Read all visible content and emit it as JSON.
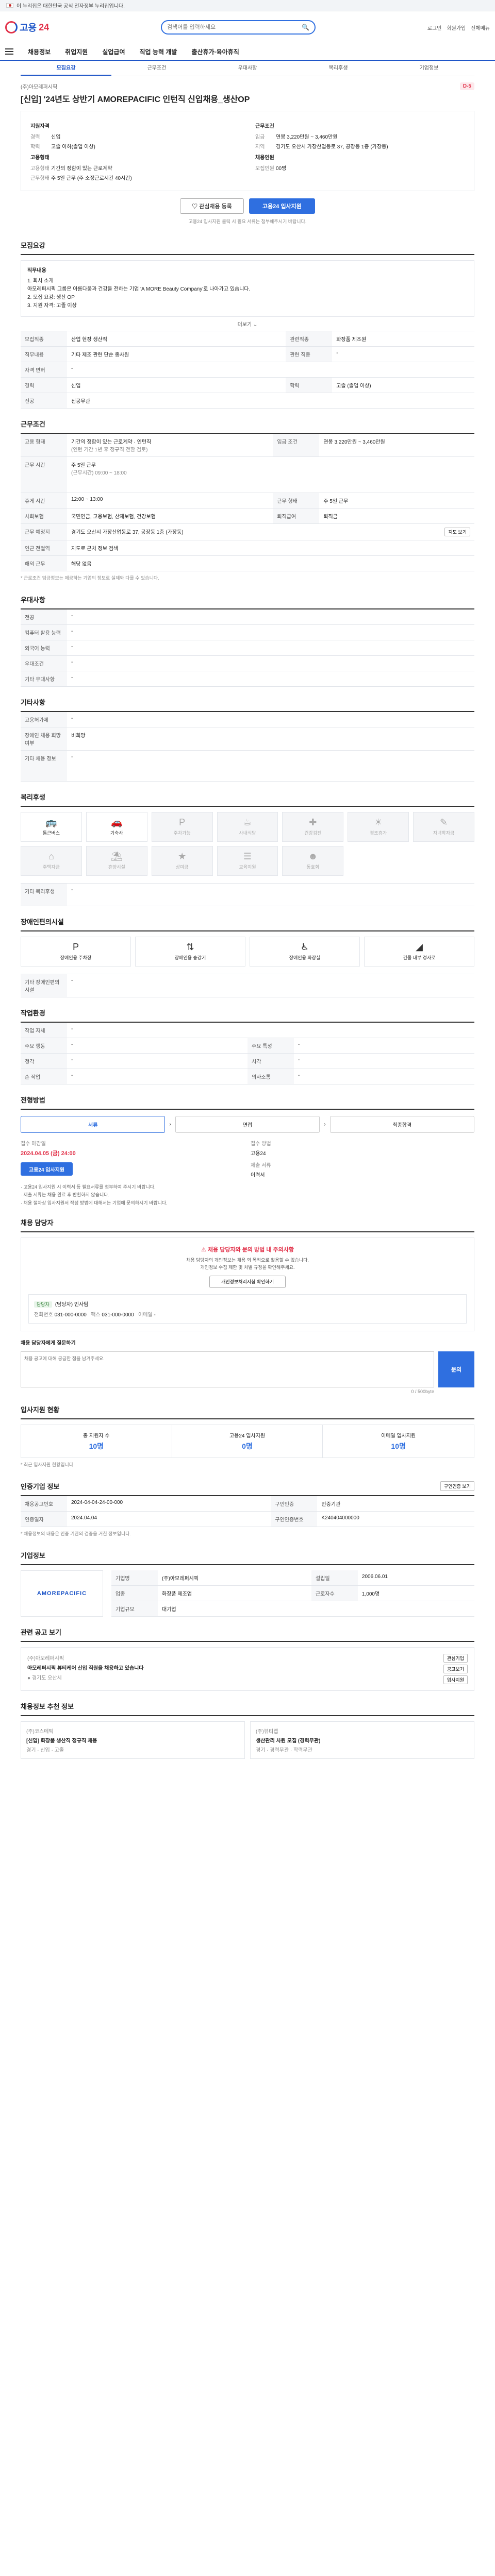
{
  "topbar": {
    "text": "이 누리집은 대한민국 공식 전자정부 누리집입니다."
  },
  "header": {
    "logo_text": "고용",
    "logo_num": "24",
    "search_placeholder": "검색어를 입력하세요",
    "links": [
      "로그인",
      "회원가입",
      "전체메뉴"
    ]
  },
  "gnb": [
    "채용정보",
    "취업지원",
    "실업급여",
    "직업 능력 개발",
    "출산휴가·육아휴직"
  ],
  "subtabs": [
    "모집요강",
    "근무조건",
    "우대사항",
    "복리후생",
    "기업정보"
  ],
  "job": {
    "company": "(주)아모레퍼시픽",
    "title": "[신입] '24년도 상반기 AMOREPACIFIC 인턴직 신입채용_생산OP",
    "dday": "D-5",
    "left_title": "지원자격",
    "left_rows": [
      {
        "k": "경력",
        "v": "신입"
      },
      {
        "k": "학력",
        "v": "고졸 이하(졸업 이상)"
      }
    ],
    "left_title2": "고용형태",
    "left_rows2": [
      {
        "k": "고용형태",
        "v": "기간의 정함이 있는 근로계약"
      },
      {
        "k": "근무형태",
        "v": "주 5일 근무 (주 소정근로시간 40시간)"
      }
    ],
    "right_title": "근무조건",
    "right_rows": [
      {
        "k": "임금",
        "v": "연봉 3,220만원 ~ 3,460만원"
      },
      {
        "k": "지역",
        "v": "경기도 오산시 가장산업동로 37, 공장동 1층 (가장동)"
      }
    ],
    "right_title2": "채용인원",
    "right_rows2": [
      {
        "k": "모집인원",
        "v": "00명"
      }
    ],
    "btn_interest": "관심채용 등록",
    "btn_apply": "고용24 입사지원",
    "small_notice": "고용24 입사지원 클릭 시 필요 서류는 첨부해주시기 바랍니다."
  },
  "recruit": {
    "section": "모집요강",
    "job_title_label": "직무내용",
    "job_lines": [
      "1. 회사 소개",
      "아모레퍼시픽 그룹은 아름다움과 건강을 전하는 기업 'A MORE Beauty Company'로 나아가고 있습니다.",
      "2. 모집 요강: 생산 OP",
      "3. 지원 자격: 고졸 이상"
    ],
    "more": "더보기",
    "rows": [
      {
        "k": "모집직종",
        "v": "산업 현장 생산직",
        "k2": "관련직종",
        "v2": "화장품 제조원"
      },
      {
        "k": "직무내용",
        "v": "기타 제조 관련 단순 종사원",
        "k2": "관련 직종",
        "v2": "-"
      },
      {
        "k": "자격 면허",
        "v": "-",
        "k2": "",
        "v2": ""
      },
      {
        "k": "경력",
        "v": "신입",
        "k2": "학력",
        "v2": "고졸 (졸업 이상)"
      },
      {
        "k": "전공",
        "v": "전공무관",
        "k2": "",
        "v2": ""
      }
    ]
  },
  "conditions": {
    "section": "근무조건",
    "type_label": "고용 형태",
    "type_value": "기간의 정함이 있는 근로계약 · 인턴직",
    "type_value2": "(인턴 기간 1년 후 정규직 전환 검토)",
    "wage_label": "임금 조건",
    "wage_value": "연봉 3,220만원 ~ 3,460만원",
    "hours_label": "근무 시간",
    "hours_value": "주 5일 근무",
    "hours_value2": "(근무시간) 09:00 ~ 18:00",
    "rows": [
      {
        "k": "휴게 시간",
        "v": "12:00 ~ 13:00",
        "k2": "근무 형태",
        "v2": "주 5일 근무"
      },
      {
        "k": "사회보험",
        "v": "국민연금, 고용보험, 산재보험, 건강보험",
        "k2": "퇴직급여",
        "v2": "퇴직금"
      },
      {
        "k": "근무 예정지",
        "v": "경기도 오산시 가장산업동로 37, 공장동 1층 (가장동)",
        "k2": "",
        "v2": ""
      },
      {
        "k": "인근 전철역",
        "v": "지도로 근처 정보 검색",
        "k2": "",
        "v2": ""
      },
      {
        "k": "해외 근무",
        "v": "해당 없음",
        "k2": "",
        "v2": ""
      }
    ],
    "map_btn": "지도 보기",
    "note": "* 근로조건 임금정보는 제공하는 기업의 정보로 실제와 다를 수 있습니다."
  },
  "preferred": {
    "section": "우대사항",
    "rows": [
      {
        "k": "전공",
        "v": "-"
      },
      {
        "k": "컴퓨터 활용 능력",
        "v": "-"
      },
      {
        "k": "외국어 능력",
        "v": "-"
      },
      {
        "k": "우대조건",
        "v": "-"
      },
      {
        "k": "기타 우대사항",
        "v": "-"
      }
    ]
  },
  "etc": {
    "section": "기타사항",
    "rows": [
      {
        "k": "고용허가제",
        "v": "-"
      },
      {
        "k": "장애인 채용 희망여부",
        "v": "비희망"
      },
      {
        "k": "기타 채용 정보",
        "v": "-"
      }
    ]
  },
  "welfare": {
    "section": "복리후생",
    "items": [
      {
        "label": "통근버스",
        "icon": "bus-icon",
        "on": true
      },
      {
        "label": "기숙사",
        "icon": "car-icon",
        "on": true
      },
      {
        "label": "주차가능",
        "icon": "parking-icon",
        "on": false
      },
      {
        "label": "사내식당",
        "icon": "meal-icon",
        "on": false
      },
      {
        "label": "건강검진",
        "icon": "health-icon",
        "on": false
      },
      {
        "label": "경조휴가",
        "icon": "leave-icon",
        "on": false
      },
      {
        "label": "자녀학자금",
        "icon": "school-icon",
        "on": false
      },
      {
        "label": "주택자금",
        "icon": "house-icon",
        "on": false
      },
      {
        "label": "휴양시설",
        "icon": "vacation-icon",
        "on": false
      },
      {
        "label": "상여금",
        "icon": "bonus-icon",
        "on": false
      },
      {
        "label": "교육지원",
        "icon": "edu-icon",
        "on": false
      },
      {
        "label": "동호회",
        "icon": "club-icon",
        "on": false
      }
    ],
    "etc_label": "기타 복리후생",
    "etc_value": "-"
  },
  "disabled": {
    "section": "장애인편의시설",
    "items": [
      {
        "label": "장애인용 주차장",
        "icon": "parking-icon"
      },
      {
        "label": "장애인용 승강기",
        "icon": "elevator-icon"
      },
      {
        "label": "장애인용 화장실",
        "icon": "toilet-icon"
      },
      {
        "label": "건물 내부 경사로",
        "icon": "ramp-icon"
      }
    ],
    "etc_label": "기타 장애인편의시설",
    "etc_value": "-"
  },
  "env": {
    "section": "작업환경",
    "rows": [
      {
        "k": "작업 자세",
        "v": "-",
        "k2": "",
        "v2": ""
      },
      {
        "k": "주요 행동",
        "v": "-",
        "k2": "주요 특성",
        "v2": "-"
      },
      {
        "k": "청각",
        "v": "-",
        "k2": "시각",
        "v2": "-"
      },
      {
        "k": "손 작업",
        "v": "-",
        "k2": "의사소통",
        "v2": "-"
      }
    ]
  },
  "process": {
    "section": "전형방법",
    "steps": [
      "서류",
      "면접",
      "최종합격"
    ],
    "deadline_label": "접수 마감일",
    "deadline_value": "2024.04.05 (금) 24:00",
    "method_label": "접수 방법",
    "method_value": "고용24",
    "docs_label": "제출 서류",
    "docs_value": "이력서",
    "apply_btn": "고용24 입사지원",
    "bullets": [
      "· 고용24 입사지원 시 이력서 등 필요서류를 첨부하여 주시기 바랍니다.",
      "· 제출 서류는 채용 완료 후 반환하지 않습니다.",
      "· 채용 절차상 입사지원서 작성 방법에 대해서는 기업에 문의하시기 바랍니다."
    ]
  },
  "contact": {
    "section": "채용 담당자",
    "alert_title": "채용 담당자와 문의 방법 내 주의사항",
    "alert_text": "채용 담당자의 개인정보는 채용 외 목적으로 활용할 수 없습니다.",
    "alert_text2": "개인정보 수집 제한 및 처벌 규정을 확인해주세요.",
    "alert_btn": "개인정보처리지침 확인하기",
    "tag": "담당자",
    "name": "(담당자) 인사팀",
    "tel_label": "전화번호",
    "tel": "031-000-0000",
    "fax_label": "팩스",
    "fax": "031-000-0000",
    "email_label": "이메일",
    "email": "-",
    "inquiry_title": "채용 담당자에게 질문하기",
    "inquiry_placeholder": "채용 공고에 대해 궁금한 점을 남겨주세요.",
    "inquiry_btn": "문의",
    "inquiry_count": "0 / 500byte"
  },
  "applicants": {
    "section": "입사지원 현황",
    "stats": [
      {
        "label": "총 지원자 수",
        "value": "10명"
      },
      {
        "label": "고용24 입사지원",
        "value": "0명"
      },
      {
        "label": "이메일 입사지원",
        "value": "10명"
      }
    ],
    "note": "* 최근 입사지원 현황입니다."
  },
  "recruit_info": {
    "section": "인증기업 정보",
    "print_btn": "구인인증 보기",
    "rows": [
      {
        "k": "채용공고번호",
        "v": "2024-04-04-24-00-000",
        "k2": "구인인증",
        "v2": "인증기관"
      },
      {
        "k": "인증일자",
        "v": "2024.04.04",
        "k2": "구인인증번호",
        "v2": "K240404000000"
      }
    ],
    "note": "* 채용정보의 내용은 인증 기관의 검증을 거친 정보입니다."
  },
  "company": {
    "section": "기업정보",
    "rows": [
      {
        "k": "기업명",
        "v": "(주)아모레퍼시픽"
      },
      {
        "k": "업종",
        "v": "화장품 제조업"
      },
      {
        "k": "기업규모",
        "v": "대기업"
      },
      {
        "k": "설립일",
        "v": "2006.06.01"
      },
      {
        "k": "근로자수",
        "v": "1,000명"
      }
    ],
    "logo": "AMOREPACIFIC"
  },
  "related": {
    "section": "관련 공고 보기",
    "company": "(주)아모레퍼시픽",
    "title": "아모레퍼시픽 뷰티케어 신입 직원을 채용하고 있습니다",
    "loc": "경기도 오산시",
    "buttons": [
      "관심기업",
      "공고보기",
      "입사지원"
    ]
  },
  "recommend": {
    "section": "채용정보 추천 정보",
    "cards": [
      {
        "company": "(주)코스메틱",
        "title": "[신입] 화장품 생산직 정규직 채용",
        "meta": "경기 · 신입 · 고졸"
      },
      {
        "company": "(주)뷰티랩",
        "title": "생산관리 사원 모집 (경력무관)",
        "meta": "경기 · 경력무관 · 학력무관"
      }
    ]
  }
}
